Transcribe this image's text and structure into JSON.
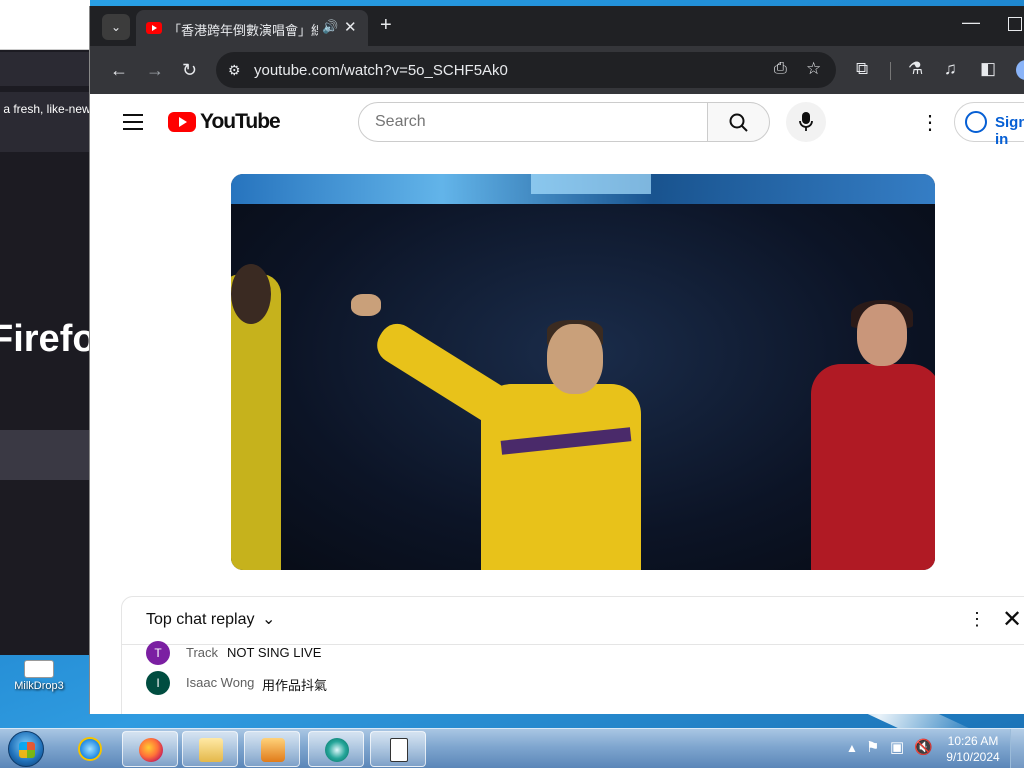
{
  "background_window": {
    "promo_text": "r a fresh, like-new",
    "big_text": "Firefo"
  },
  "desktop": {
    "icons": [
      {
        "label": "MilkDrop3"
      }
    ]
  },
  "browser": {
    "tab": {
      "title": "「香港跨年倒數演唱會」線上",
      "audio_icon": "speaker-icon"
    },
    "omnibox": {
      "url": "youtube.com/watch?v=5o_SCHF5Ak0"
    }
  },
  "youtube": {
    "logo_text": "YouTube",
    "search": {
      "placeholder": "Search"
    },
    "sign_in_label": "Sign in"
  },
  "chat": {
    "title": "Top chat replay",
    "messages": [
      {
        "avatar_letter": "T",
        "avatar_color": "#7b1fa2",
        "author": "Track",
        "text": "NOT SING LIVE"
      },
      {
        "avatar_letter": "I",
        "avatar_color": "#004d40",
        "author": "Isaac Wong",
        "text": "用作品抖氣"
      }
    ]
  },
  "taskbar": {
    "apps": [
      {
        "name": "internet-explorer"
      },
      {
        "name": "firefox"
      },
      {
        "name": "windows-explorer"
      },
      {
        "name": "media-player"
      },
      {
        "name": "chrome"
      },
      {
        "name": "notepad"
      }
    ],
    "clock": {
      "time": "10:26 AM",
      "date": "9/10/2024"
    }
  }
}
